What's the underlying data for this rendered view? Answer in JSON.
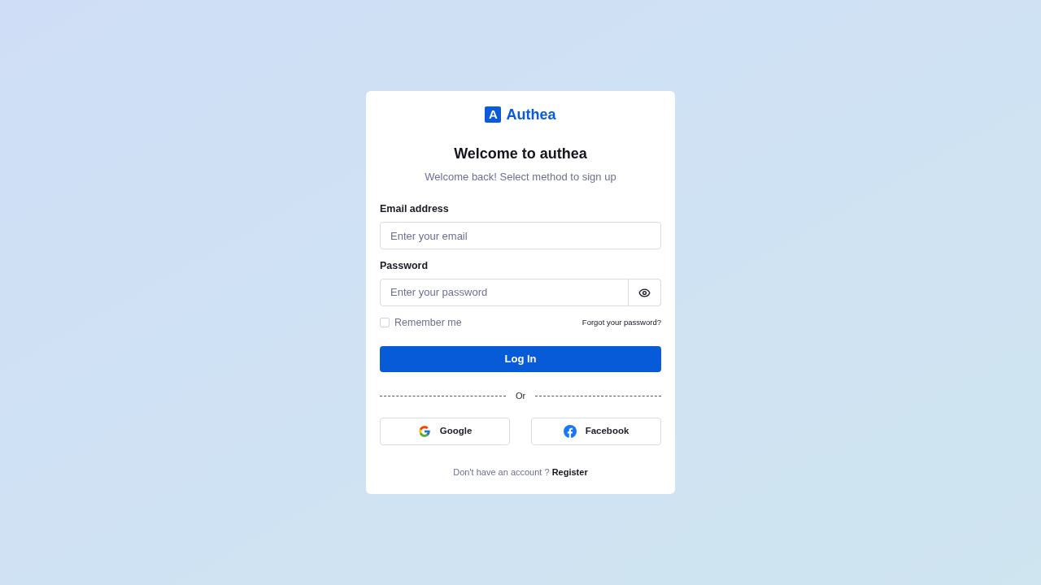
{
  "logo": {
    "mark": "A",
    "name": "Authea"
  },
  "heading": "Welcome to authea",
  "subheading": "Welcome back! Select method to sign up",
  "form": {
    "fields": [
      {
        "kind": "text",
        "label": "Email address",
        "placeholder": "Enter your email"
      },
      {
        "kind": "password",
        "label": "Password",
        "placeholder": "Enter your password"
      }
    ],
    "remember": {
      "label": "Remember me",
      "checked": false
    },
    "forgot_link": "Forgot your password?",
    "submit": "Log In"
  },
  "divider": "Or",
  "social_buttons": [
    {
      "kind": "google",
      "label": "Google"
    },
    {
      "kind": "facebook",
      "label": "Facebook"
    }
  ],
  "footer": {
    "prompt": "Don't have an account ?",
    "link": "Register"
  }
}
